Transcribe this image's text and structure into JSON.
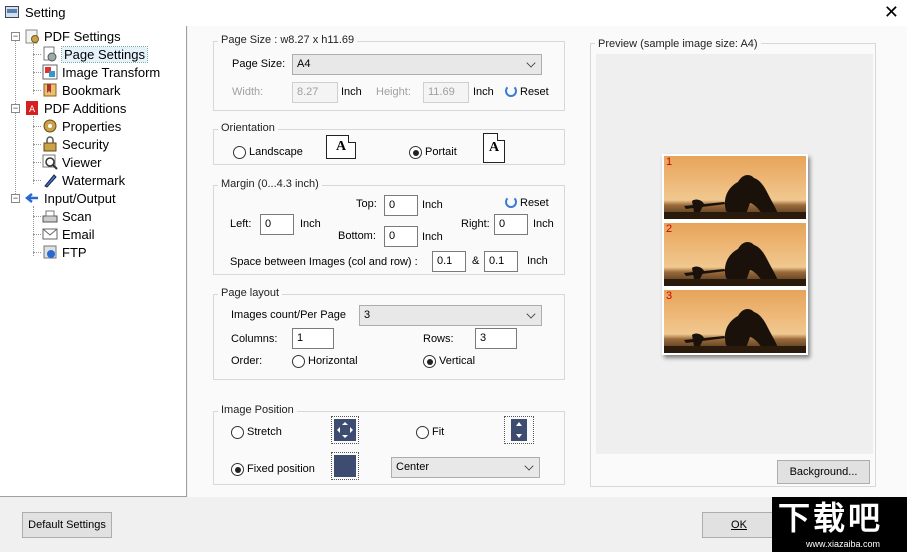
{
  "window": {
    "title": "Setting",
    "close_glyph": "✕"
  },
  "tree": {
    "items": [
      {
        "label": "PDF Settings",
        "icon": "pdf-settings-icon"
      },
      {
        "label": "Page Settings",
        "icon": "page-settings-icon"
      },
      {
        "label": "Image Transform",
        "icon": "image-transform-icon"
      },
      {
        "label": "Bookmark",
        "icon": "bookmark-icon"
      },
      {
        "label": "PDF Additions",
        "icon": "pdf-additions-icon"
      },
      {
        "label": "Properties",
        "icon": "properties-icon"
      },
      {
        "label": "Security",
        "icon": "security-icon"
      },
      {
        "label": "Viewer",
        "icon": "viewer-icon"
      },
      {
        "label": "Watermark",
        "icon": "watermark-icon"
      },
      {
        "label": "Input/Output",
        "icon": "input-output-icon"
      },
      {
        "label": "Scan",
        "icon": "scanner-icon"
      },
      {
        "label": "Email",
        "icon": "email-icon"
      },
      {
        "label": "FTP",
        "icon": "ftp-icon"
      }
    ],
    "selected": "Page Settings"
  },
  "page_size": {
    "title": "Page Size : w8.27 x h11.69",
    "label": "Page Size:",
    "value": "A4",
    "width_label": "Width:",
    "width_value": "8.27",
    "height_label": "Height:",
    "height_value": "11.69",
    "unit": "Inch",
    "reset": "Reset"
  },
  "orientation": {
    "title": "Orientation",
    "landscape": "Landscape",
    "portrait": "Portait",
    "glyph": "A",
    "selected": "portrait"
  },
  "margin": {
    "title": "Margin (0...4.3 inch)",
    "top_label": "Top:",
    "top_value": "0",
    "left_label": "Left:",
    "left_value": "0",
    "right_label": "Right:",
    "right_value": "0",
    "bottom_label": "Bottom:",
    "bottom_value": "0",
    "unit": "Inch",
    "reset": "Reset",
    "space_label": "Space between Images (col and row) :",
    "space_col": "0.1",
    "amp": "&",
    "space_row": "0.1"
  },
  "layout": {
    "title": "Page layout",
    "count_label": "Images count/Per Page",
    "count_value": "3",
    "columns_label": "Columns:",
    "columns_value": "1",
    "rows_label": "Rows:",
    "rows_value": "3",
    "order_label": "Order:",
    "horizontal": "Horizontal",
    "vertical": "Vertical",
    "selected": "vertical"
  },
  "position": {
    "title": "Image Position",
    "stretch": "Stretch",
    "fit": "Fit",
    "fixed": "Fixed position",
    "selected": "fixed",
    "align_value": "Center"
  },
  "preview": {
    "title": "Preview (sample image size: A4)",
    "numbers": [
      "1",
      "2",
      "3"
    ],
    "background_button": "Background..."
  },
  "footer": {
    "default_button": "Default Settings",
    "ok_button": "OK"
  },
  "watermark": {
    "big": "下载吧",
    "small": "www.xiazaiba.com"
  },
  "colors": {
    "accent": "#3d4c70",
    "selection": "#e5f1fb",
    "preview_number": "#d00000"
  }
}
